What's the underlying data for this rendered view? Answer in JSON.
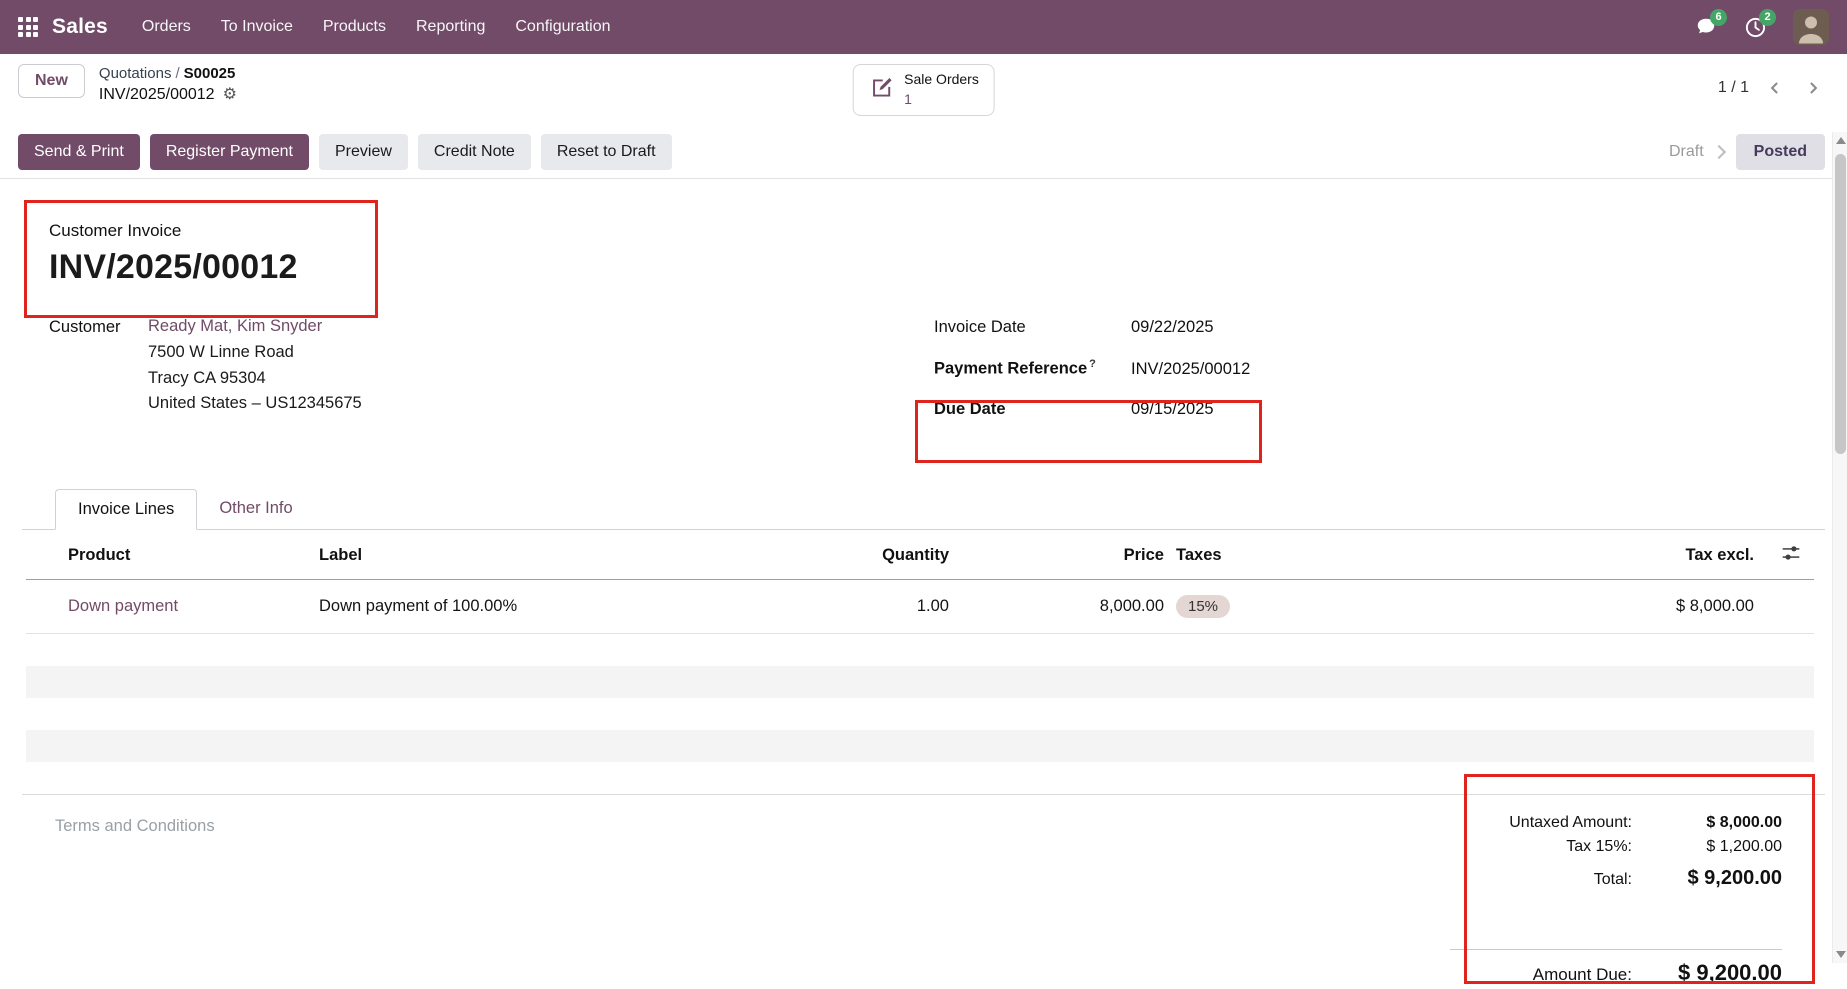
{
  "colors": {
    "primary": "#714B67",
    "annotation_red": "#df231d",
    "badge_green": "#44a567",
    "posted_bg": "#e0dfe6",
    "tax_tag_bg": "#e4d6d2"
  },
  "nav": {
    "brand": "Sales",
    "items": [
      "Orders",
      "To Invoice",
      "Products",
      "Reporting",
      "Configuration"
    ],
    "messages_badge": "6",
    "activities_badge": "2"
  },
  "control": {
    "new_button": "New",
    "breadcrumb_parent": "Quotations",
    "breadcrumb_origin": "S00025",
    "breadcrumb_current": "INV/2025/00012",
    "stat_button_label": "Sale Orders",
    "stat_button_count": "1",
    "pager": "1 / 1"
  },
  "actions": {
    "send_print": "Send & Print",
    "register_payment": "Register Payment",
    "preview": "Preview",
    "credit_note": "Credit Note",
    "reset_to_draft": "Reset to Draft"
  },
  "status": {
    "draft": "Draft",
    "posted": "Posted"
  },
  "doc": {
    "type_label": "Customer Invoice",
    "number": "INV/2025/00012",
    "customer_label": "Customer",
    "customer_name": "Ready Mat, Kim Snyder",
    "address_line1": "7500 W Linne Road",
    "address_line2": "Tracy CA 95304",
    "address_line3": "United States – US12345675",
    "invoice_date_label": "Invoice Date",
    "invoice_date": "09/22/2025",
    "payment_reference_label": "Payment Reference",
    "payment_reference_help": "?",
    "payment_reference": "INV/2025/00012",
    "due_date_label": "Due Date",
    "due_date": "09/15/2025"
  },
  "tabs": {
    "invoice_lines": "Invoice Lines",
    "other_info": "Other Info"
  },
  "table": {
    "headers": {
      "product": "Product",
      "label": "Label",
      "quantity": "Quantity",
      "price": "Price",
      "taxes": "Taxes",
      "tax_excl": "Tax excl."
    },
    "rows": [
      {
        "product": "Down payment",
        "label": "Down payment of 100.00%",
        "quantity": "1.00",
        "price": "8,000.00",
        "taxes": "15%",
        "tax_excl": "$ 8,000.00"
      }
    ]
  },
  "footer": {
    "terms_placeholder": "Terms and Conditions",
    "untaxed_label": "Untaxed Amount:",
    "untaxed_value": "$ 8,000.00",
    "tax_label": "Tax 15%:",
    "tax_value": "$ 1,200.00",
    "total_label": "Total:",
    "total_value": "$ 9,200.00",
    "amount_due_label": "Amount Due:",
    "amount_due_value": "$ 9,200.00"
  }
}
